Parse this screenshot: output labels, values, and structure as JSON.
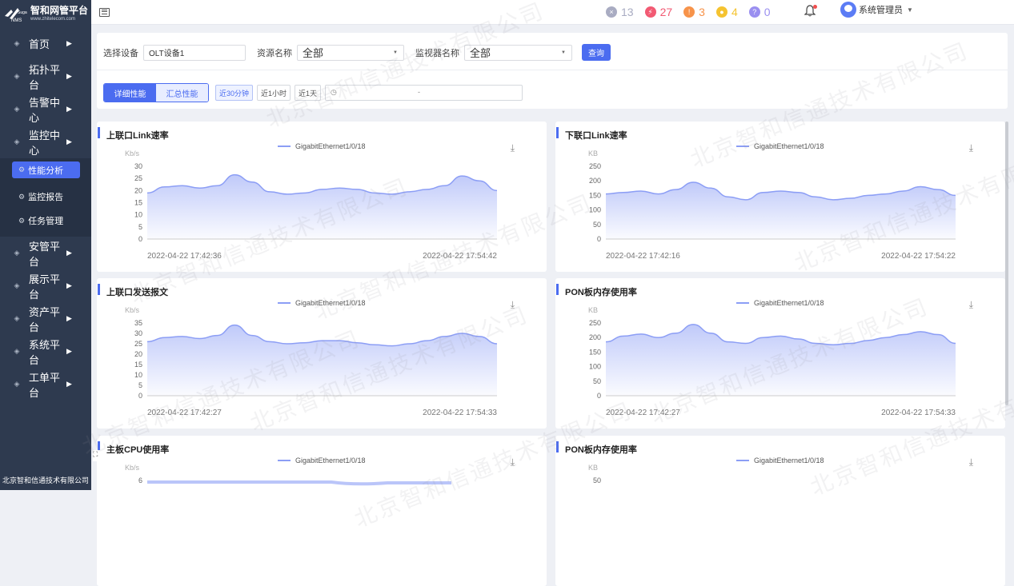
{
  "app": {
    "title": "智和网管平台",
    "url": "www.zhitelecom.com",
    "footer": "北京智和信通技术有限公司"
  },
  "sidebar": {
    "items": [
      {
        "label": "首页",
        "icon": "home-icon"
      },
      {
        "label": "拓扑平台",
        "icon": "topology-icon"
      },
      {
        "label": "告警中心",
        "icon": "alarm-icon"
      },
      {
        "label": "监控中心",
        "icon": "monitor-icon"
      }
    ],
    "sub_items": [
      {
        "label": "性能分析",
        "active": true
      },
      {
        "label": "监控报告",
        "active": false
      },
      {
        "label": "任务管理",
        "active": false
      }
    ],
    "items_after": [
      {
        "label": "安管平台",
        "icon": "security-icon"
      },
      {
        "label": "展示平台",
        "icon": "display-icon"
      },
      {
        "label": "资产平台",
        "icon": "asset-icon"
      },
      {
        "label": "系统平台",
        "icon": "system-icon"
      },
      {
        "label": "工单平台",
        "icon": "ticket-icon"
      }
    ]
  },
  "header": {
    "badges": [
      {
        "name": "critical",
        "count": "13",
        "color": "#a9acc2",
        "icon": "×"
      },
      {
        "name": "major",
        "count": "27",
        "color": "#f25a73",
        "icon": "⚡"
      },
      {
        "name": "minor",
        "count": "3",
        "color": "#f7934a",
        "icon": "!"
      },
      {
        "name": "warning",
        "count": "4",
        "color": "#f5c330",
        "icon": "●"
      },
      {
        "name": "info",
        "count": "0",
        "color": "#9a8ff0",
        "icon": "?"
      }
    ],
    "user": "系统管理员"
  },
  "filter": {
    "device_label": "选择设备",
    "device_value": "OLT设备1",
    "resource_label": "资源名称",
    "resource_value": "全部",
    "monitor_label": "监视器名称",
    "monitor_value": "全部",
    "query": "查询",
    "tab_detail": "详细性能",
    "tab_summary": "汇总性能",
    "ranges": [
      "近30分钟",
      "近1小时",
      "近1天"
    ],
    "date_sep": "-"
  },
  "chart_data": [
    {
      "type": "area",
      "title": "上联口Link速率",
      "series": [
        {
          "name": "GigabitEthernet1/0/18",
          "values": [
            19,
            21.5,
            22,
            21,
            22,
            26.5,
            23.5,
            19.5,
            18.5,
            19,
            20.5,
            21,
            20.5,
            19,
            18.5,
            19.5,
            20.5,
            22,
            26,
            24,
            20
          ]
        }
      ],
      "ylabel": "Kb/s",
      "ylim": [
        0,
        30
      ],
      "yticks": [
        0,
        5,
        10,
        15,
        20,
        25,
        30
      ],
      "x_first": "2022-04-22 17:42:36",
      "x_last": "2022-04-22 17:54:42"
    },
    {
      "type": "area",
      "title": "下联口Link速率",
      "series": [
        {
          "name": "GigabitEthernet1/0/18",
          "values": [
            155,
            160,
            165,
            155,
            170,
            195,
            175,
            145,
            135,
            160,
            165,
            160,
            145,
            135,
            140,
            150,
            155,
            165,
            180,
            170,
            150
          ]
        }
      ],
      "ylabel": "KB",
      "ylim": [
        0,
        250
      ],
      "yticks": [
        0,
        50,
        100,
        150,
        200,
        250
      ],
      "x_first": "2022-04-22 17:42:16",
      "x_last": "2022-04-22 17:54:22"
    },
    {
      "type": "area",
      "title": "上联口发送报文",
      "series": [
        {
          "name": "GigabitEthernet1/0/18",
          "values": [
            26,
            28,
            28.5,
            27.5,
            29,
            34,
            29,
            26,
            25,
            25.5,
            26.5,
            26.5,
            25.5,
            24.5,
            24,
            25,
            26.5,
            28.5,
            30,
            28.5,
            25
          ]
        }
      ],
      "ylabel": "Kb/s",
      "ylim": [
        0,
        35
      ],
      "yticks": [
        0,
        5,
        10,
        15,
        20,
        25,
        30,
        35
      ],
      "x_first": "2022-04-22 17:42:27",
      "x_last": "2022-04-22 17:54:33"
    },
    {
      "type": "area",
      "title": "PON板内存使用率",
      "series": [
        {
          "name": "GigabitEthernet1/0/18",
          "values": [
            185,
            205,
            212,
            200,
            215,
            245,
            215,
            185,
            180,
            200,
            205,
            195,
            180,
            175,
            180,
            190,
            200,
            210,
            220,
            210,
            180
          ]
        }
      ],
      "ylabel": "KB",
      "ylim": [
        0,
        250
      ],
      "yticks": [
        0,
        50,
        100,
        150,
        200,
        250
      ],
      "x_first": "2022-04-22 17:42:27",
      "x_last": "2022-04-22 17:54:33"
    },
    {
      "type": "area",
      "title": "主板CPU使用率",
      "series": [
        {
          "name": "GigabitEthernet1/0/18",
          "values": []
        }
      ],
      "ylabel": "Kb/s",
      "yticks": [
        6
      ],
      "x_first": "",
      "x_last": ""
    },
    {
      "type": "area",
      "title": "PON板内存使用率",
      "series": [
        {
          "name": "GigabitEthernet1/0/18",
          "values": []
        }
      ],
      "ylabel": "KB",
      "yticks": [
        50
      ],
      "x_first": "",
      "x_last": ""
    }
  ],
  "watermark": "北京智和信通技术有限公司"
}
